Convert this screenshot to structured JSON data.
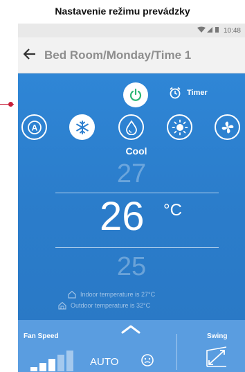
{
  "caption": "Nastavenie režimu prevádzky",
  "status_bar": {
    "time": "10:48",
    "icons": "wifi-signal-battery"
  },
  "header": {
    "title": "Bed Room/Monday/Time 1"
  },
  "controls": {
    "timer_label": "Timer"
  },
  "modes": {
    "items": [
      {
        "name": "auto",
        "icon": "auto-mode-icon",
        "active": false
      },
      {
        "name": "cool",
        "icon": "snowflake-icon",
        "active": true
      },
      {
        "name": "dry",
        "icon": "water-drop-icon",
        "active": false
      },
      {
        "name": "heat",
        "icon": "sun-icon",
        "active": false
      },
      {
        "name": "fan",
        "icon": "fan-icon",
        "active": false
      }
    ],
    "selected_label": "Cool"
  },
  "temperature": {
    "upper": "27",
    "current": "26",
    "unit": "°C",
    "lower": "25"
  },
  "info": {
    "indoor": "Indoor temperature is  27°C",
    "outdoor": "Outdoor temperature is  32°C"
  },
  "bottom": {
    "fan_speed_label": "Fan Speed",
    "fan_speed_value": "AUTO",
    "swing_label": "Swing"
  },
  "colors": {
    "background": "#2d7fcf",
    "panel": "#5a9de0",
    "pointer": "#c8203a"
  }
}
